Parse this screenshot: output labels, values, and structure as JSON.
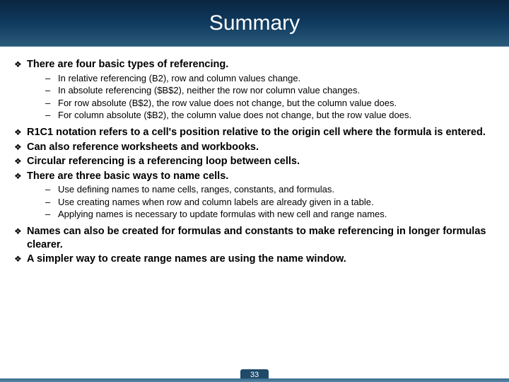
{
  "title": "Summary",
  "pageNumber": "33",
  "bullets": [
    {
      "text": "There are four basic types of referencing.",
      "bold": true,
      "sub": [
        "In relative referencing (B2), row and column values change.",
        "In absolute referencing ($B$2), neither the row nor column value changes.",
        "For row absolute (B$2), the row value does not change, but the column value does.",
        "For column absolute ($B2), the column value does not change, but the row value does."
      ]
    },
    {
      "text": "R1C1 notation refers to a cell's position relative to the origin cell where the formula is entered.",
      "bold": true
    },
    {
      "text": "Can also reference worksheets and workbooks.",
      "bold": true
    },
    {
      "text": "Circular referencing is a referencing loop between cells.",
      "bold": true
    },
    {
      "text": "There are three basic ways to name cells.",
      "bold": true,
      "sub": [
        "Use defining names to name cells, ranges, constants, and formulas.",
        "Use creating names when row and column labels are already given in a table.",
        "Applying names is necessary to update formulas with new cell and range names."
      ]
    },
    {
      "text": "Names can also be created for formulas and constants to make referencing in longer formulas clearer.",
      "bold": true
    },
    {
      "text": "A simpler way to create range names are using the name window.",
      "bold": true
    }
  ]
}
